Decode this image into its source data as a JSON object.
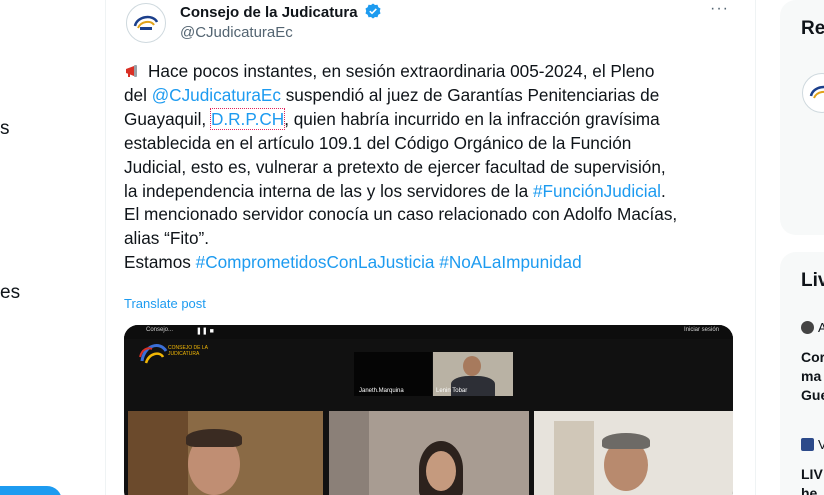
{
  "left_nav": {
    "frag1": "s",
    "frag2": "es"
  },
  "post": {
    "display_name": "Consejo de la Judicatura",
    "handle": "@CJudicaturaEc",
    "more": "···",
    "text": {
      "l1_a": "Hace pocos instantes, en sesión extraordinaria 005-2024, el Pleno",
      "l2_a": "del ",
      "l2_mention": "@CJudicaturaEc",
      "l2_b": " suspendió al juez de Garantías Penitenciarias de",
      "l3_a": "Guayaquil, ",
      "l3_initials": "D.R.P.CH",
      "l3_b": ", quien habría incurrido en la infracción gravísima",
      "l4": "establecida en el artículo 109.1 del Código Orgánico de la Función",
      "l5": "Judicial, esto es, vulnerar a pretexto de ejercer facultad de supervisión,",
      "l6_a": "la independencia interna de las y los servidores de la ",
      "l6_hashtag": "#FunciónJudicial",
      "l6_b": ".",
      "l7": "El mencionado servidor conocía un caso relacionado con Adolfo Macías,",
      "l8": "alias “Fito”.",
      "l9_a": "Estamos ",
      "l9_hashtag1": "#ComprometidosConLaJusticia",
      "l9_space": " ",
      "l9_hashtag2": "#NoALaImpunidad"
    },
    "translate": "Translate post",
    "media": {
      "top_left": "Consejo...",
      "top_right": "Iniciar sesión",
      "logo_text": "CONSEJO DE LA JUDICATURA",
      "tile1_label": "Janeth.Marquina",
      "tile2_label": "Lenin Tobar"
    }
  },
  "right_column": {
    "card1_title": "Re",
    "card2_title": "Liv",
    "item1_meta": "A",
    "item1_lines": [
      "Cor",
      "ma",
      "Gue"
    ],
    "item2_meta": "V",
    "item2_lines": [
      "LIV",
      "he"
    ]
  },
  "colors": {
    "link": "#1d9bf0",
    "text": "#0f1419",
    "muted": "#536471",
    "verified": "#1d9bf0"
  }
}
